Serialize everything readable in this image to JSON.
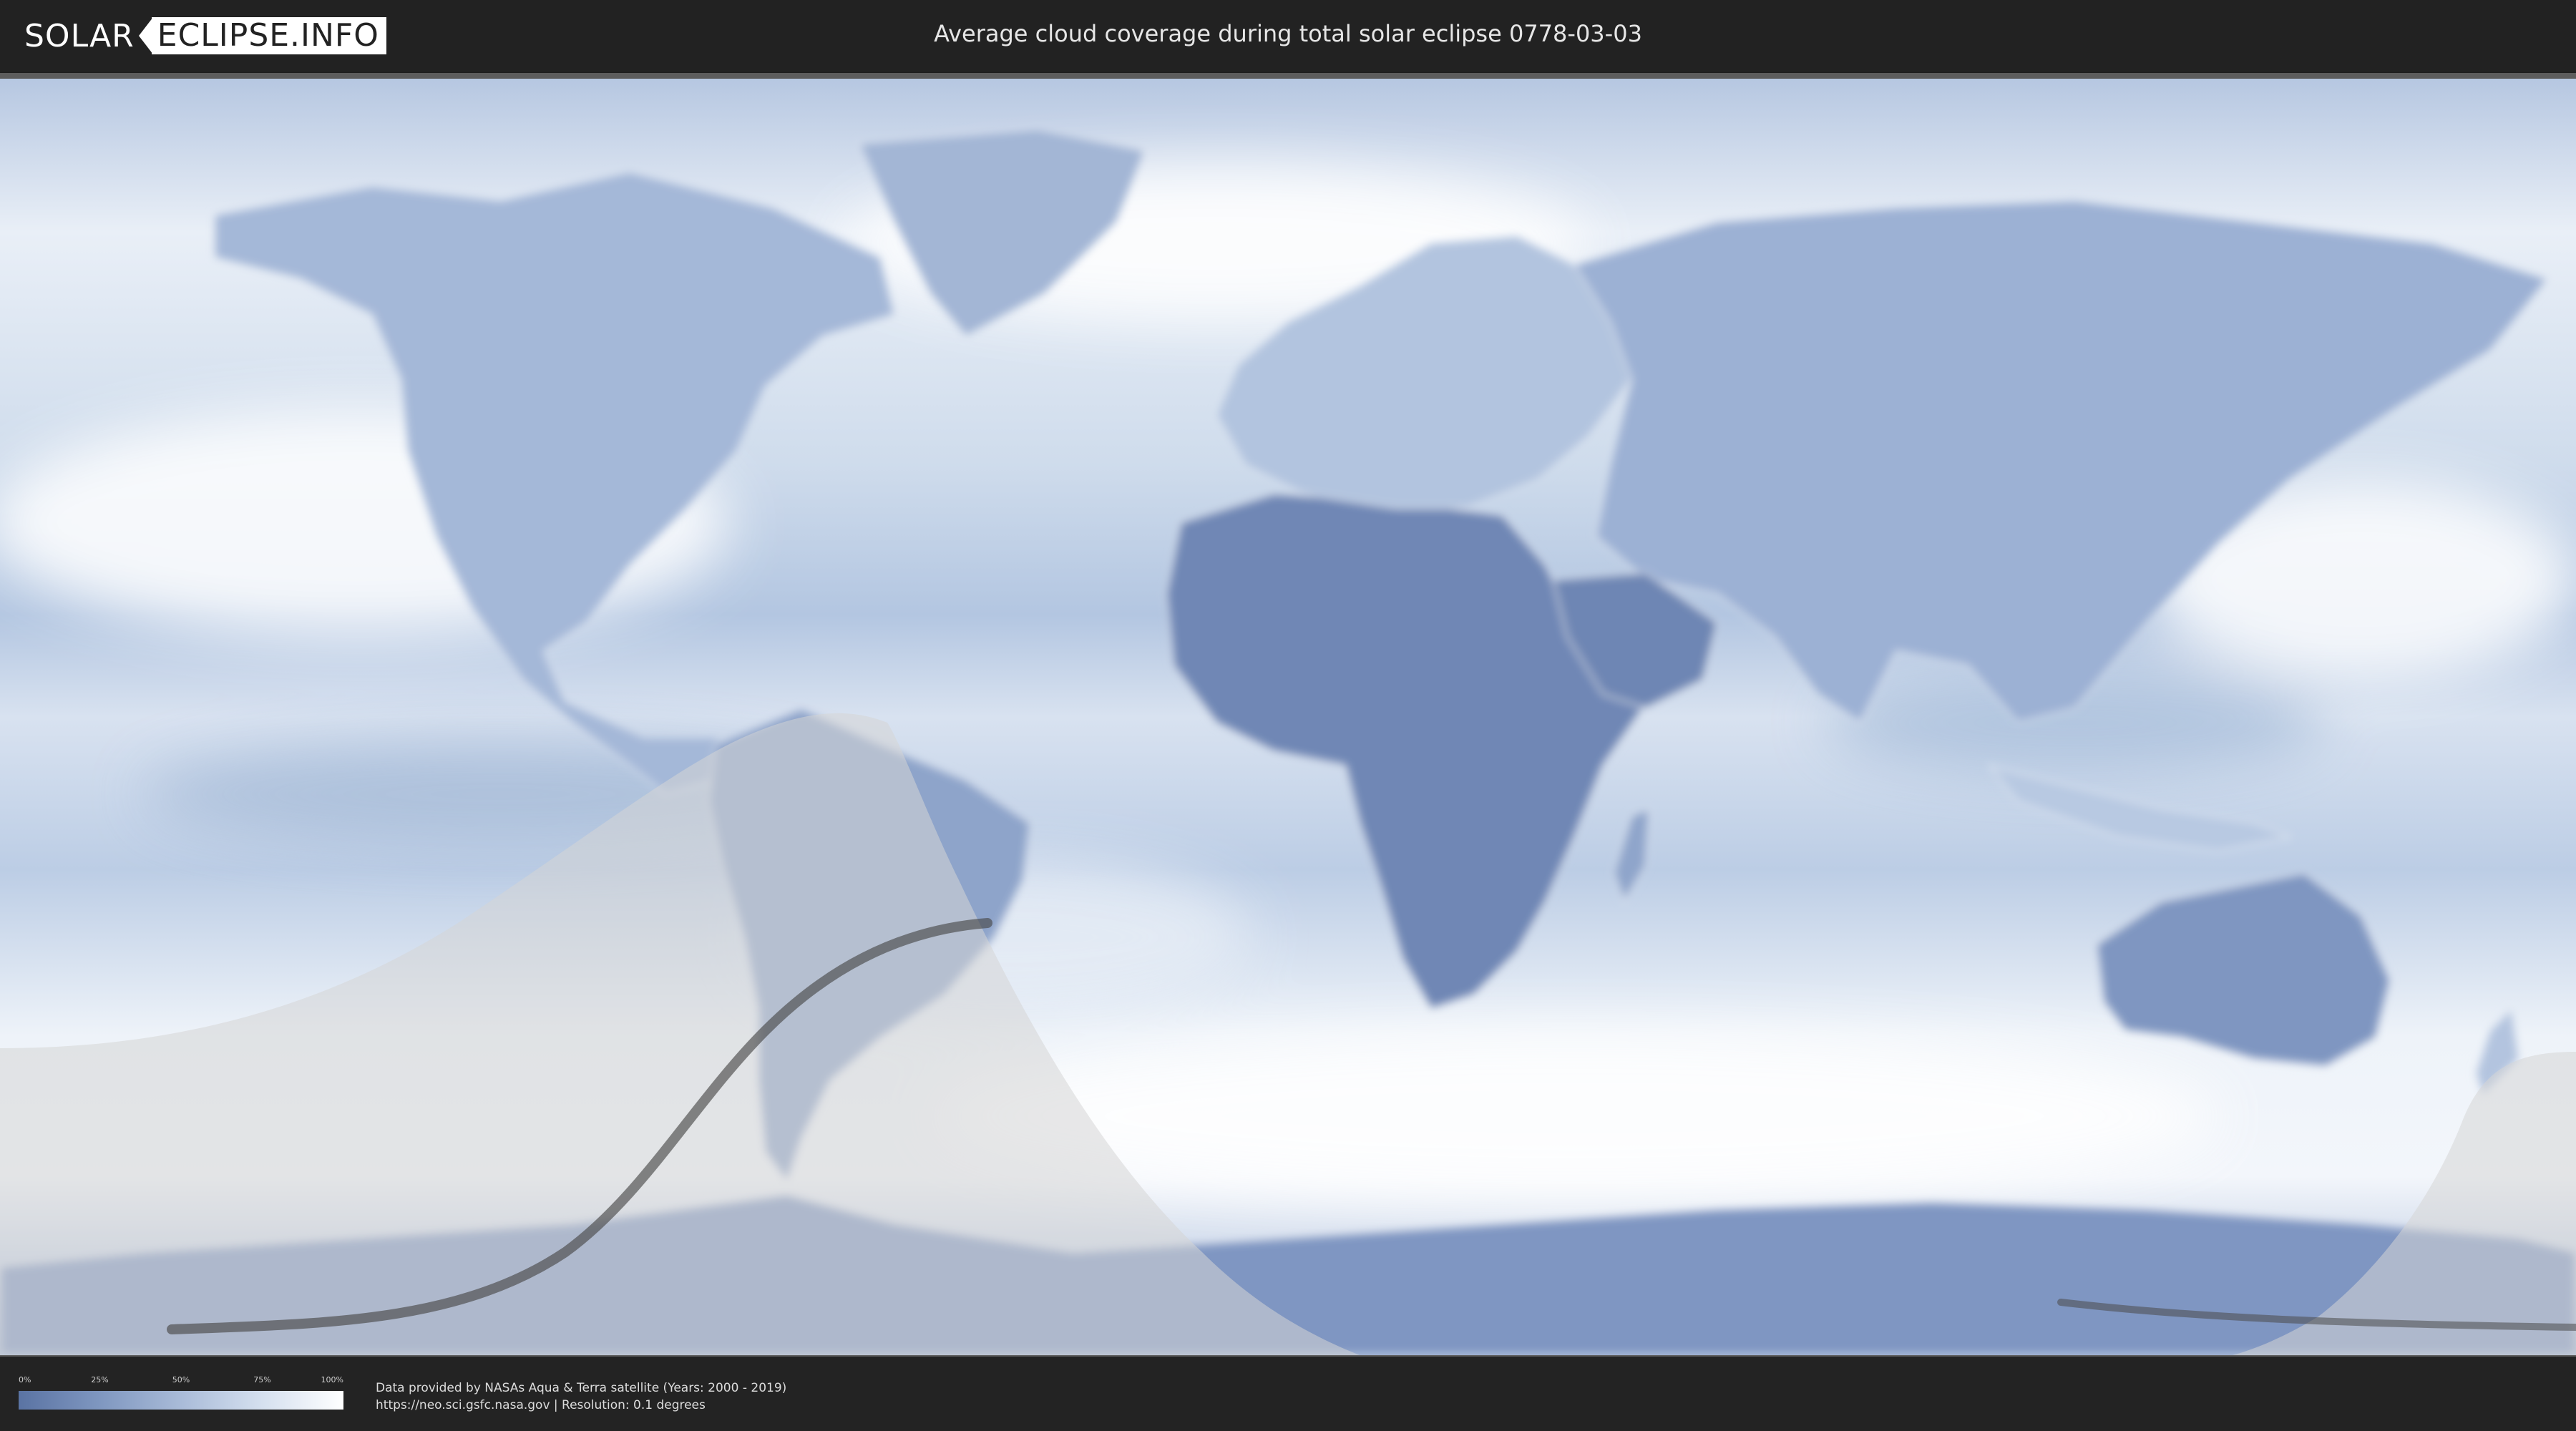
{
  "header": {
    "logo_left": "SOLAR",
    "logo_right": "ECLIPSE.INFO",
    "title": "Average cloud coverage during total solar eclipse 0778-03-03"
  },
  "legend": {
    "ticks": [
      "0%",
      "25%",
      "50%",
      "75%",
      "100%"
    ],
    "colors": [
      "#5a73a3",
      "#7f97c0",
      "#a9bbd8",
      "#d5e0ef",
      "#ffffff"
    ]
  },
  "footer": {
    "credit_line1": "Data provided by NASAs Aqua & Terra satellite (Years: 2000 - 2019)",
    "credit_line2": "https://neo.sci.gsfc.nasa.gov | Resolution: 0.1 degrees"
  },
  "map": {
    "ocean_color": "#c7d5e8",
    "land_clear_color": "#6f87b5",
    "shadow_color": "#d9d9d9",
    "path_color": "#444444"
  }
}
